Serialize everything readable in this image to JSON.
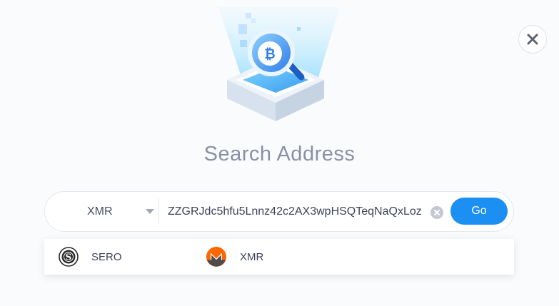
{
  "colors": {
    "accent": "#1b8ff2",
    "title": "#8a8fa8",
    "text": "#3e4358"
  },
  "icons": {
    "close": "close-icon",
    "hero": "bitcoin-search-illustration",
    "clear": "clear-icon",
    "caret": "chevron-down-icon",
    "sero": "sero-coin-icon",
    "xmr": "monero-coin-icon"
  },
  "header": {
    "title": "Search Address"
  },
  "search": {
    "selected_coin": "XMR",
    "address_value": "ZZGRJdc5hfu5Lnnz42c2AX3wpHSQTeqNaQxLoz",
    "go_label": "Go"
  },
  "dropdown": {
    "options": [
      {
        "label": "SERO",
        "icon": "sero-coin-icon"
      },
      {
        "label": "XMR",
        "icon": "monero-coin-icon"
      }
    ]
  }
}
